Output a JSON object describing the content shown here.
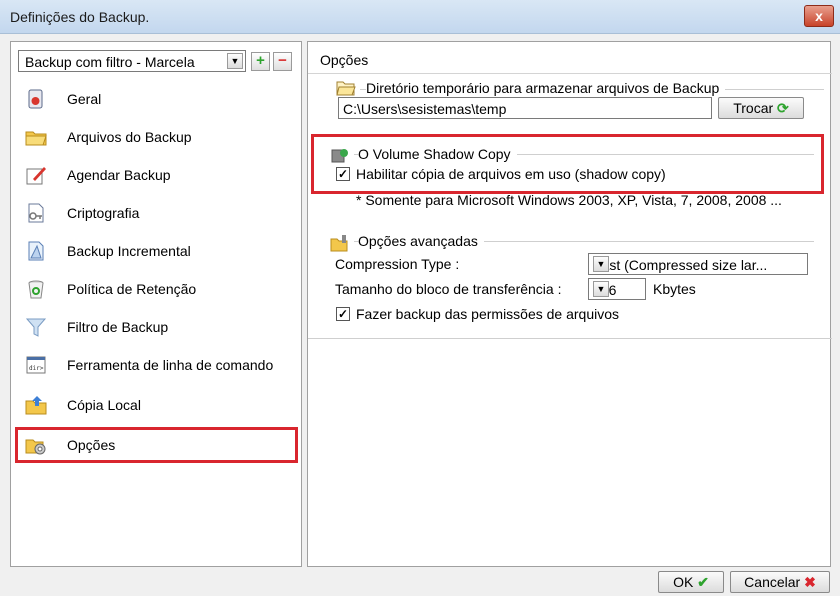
{
  "window": {
    "title": "Definições do Backup.",
    "close_label": "x"
  },
  "sidebar": {
    "combo_value": "Backup com filtro - Marcela",
    "add_label": "+",
    "remove_label": "−",
    "items": [
      {
        "label": "Geral",
        "icon": "general-icon"
      },
      {
        "label": "Arquivos do Backup",
        "icon": "folder-icon"
      },
      {
        "label": "Agendar Backup",
        "icon": "schedule-icon"
      },
      {
        "label": "Criptografia",
        "icon": "key-icon"
      },
      {
        "label": "Backup Incremental",
        "icon": "incremental-icon"
      },
      {
        "label": "Política de Retenção",
        "icon": "recycle-bin-icon"
      },
      {
        "label": "Filtro de Backup",
        "icon": "filter-icon"
      },
      {
        "label": "Ferramenta de linha de comando",
        "icon": "command-line-icon"
      },
      {
        "label": "Cópia Local",
        "icon": "local-copy-icon"
      },
      {
        "label": "Opções",
        "icon": "options-icon"
      }
    ],
    "selected": "Opções"
  },
  "options": {
    "title": "Opções",
    "temp_dir": {
      "group_title": "Diretório temporário para armazenar arquivos  de Backup",
      "path_value": "C:\\Users\\sesistemas\\temp",
      "change_button": "Trocar"
    },
    "shadow_copy": {
      "group_title": "O Volume Shadow Copy",
      "checkbox_label": "Habilitar cópia de arquivos em uso (shadow copy)",
      "checked": true,
      "note": "* Somente para Microsoft Windows 2003, XP, Vista, 7, 2008, 2008 ..."
    },
    "advanced": {
      "group_title": "Opções avançadas",
      "compression_label": "Compression Type :",
      "compression_value": "Fast (Compressed size lar...",
      "block_label": "Tamanho do bloco de transferência :",
      "block_value": "256",
      "block_unit": "Kbytes",
      "permissions_label": "Fazer backup das permissões de arquivos",
      "permissions_checked": true
    }
  },
  "footer": {
    "ok_label": "OK",
    "cancel_label": "Cancelar"
  },
  "colors": {
    "highlight_red": "#d9262e",
    "title_bar": "#c3d7ee",
    "check_green": "#2ea32e"
  }
}
